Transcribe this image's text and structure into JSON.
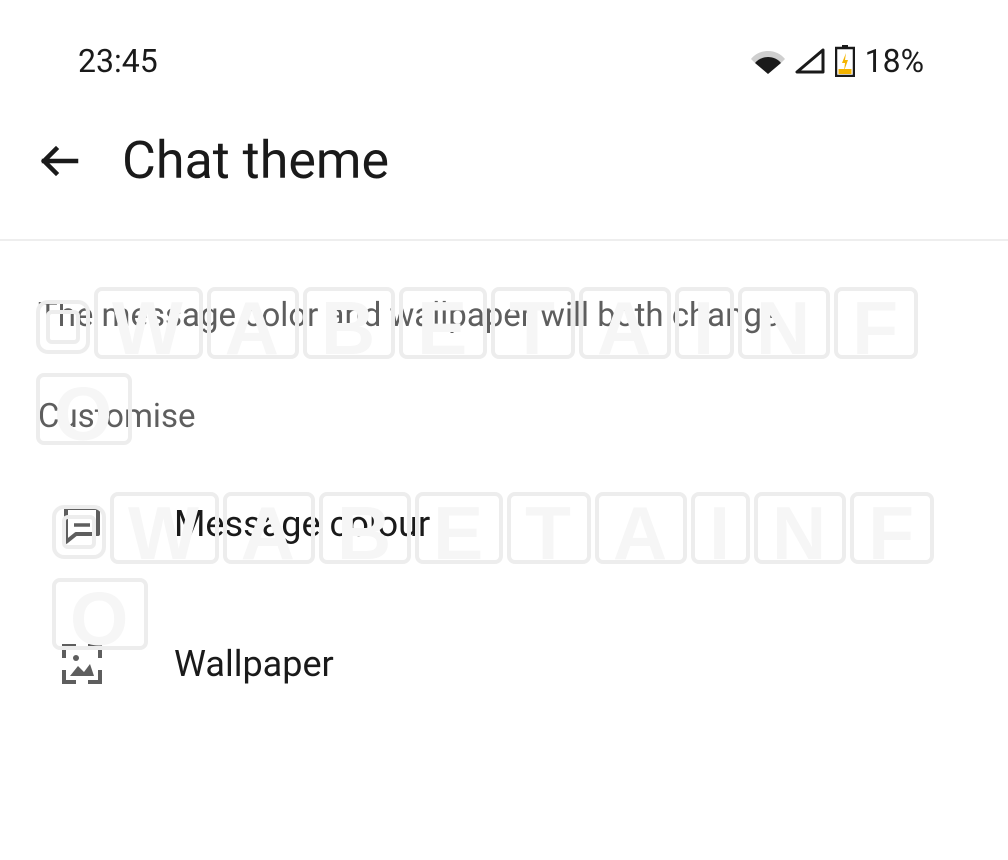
{
  "status_bar": {
    "time": "23:45",
    "battery_percent": "18%"
  },
  "app_bar": {
    "title": "Chat theme"
  },
  "description": "The message color and wallpaper will both change.",
  "section_header": "Customise",
  "items": [
    {
      "label": "Message colour"
    },
    {
      "label": "Wallpaper"
    }
  ],
  "watermark_chars": [
    "W",
    "A",
    "B",
    "E",
    "T",
    "A",
    "I",
    "N",
    "F",
    "O"
  ]
}
